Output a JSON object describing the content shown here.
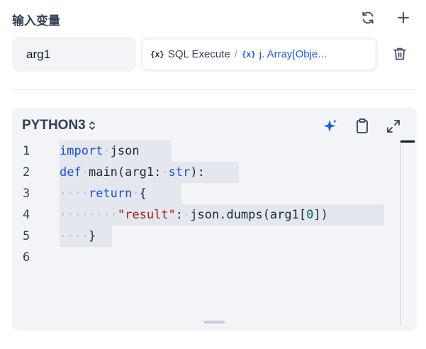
{
  "section": {
    "title": "输入变量"
  },
  "variable": {
    "name": "arg1",
    "source_node_icon": "{x}",
    "source_node": "SQL Execute",
    "separator": "/",
    "source_var_icon": "{x}",
    "source_var": "j. Array[Obje..."
  },
  "editor": {
    "language": "PYTHON3",
    "line_numbers": [
      "1",
      "2",
      "3",
      "4",
      "5",
      "6"
    ]
  },
  "icons": {
    "refresh": "refresh-icon",
    "add": "plus-icon",
    "trash": "trash-icon",
    "sparkle": "sparkle-icon",
    "clipboard": "clipboard-icon",
    "expand": "expand-icon"
  },
  "colors": {
    "accent": "#155eef",
    "keyword": "#1a4fd6",
    "string": "#a21d1d",
    "number": "#116644",
    "panel_bg": "#f2f4f7"
  }
}
